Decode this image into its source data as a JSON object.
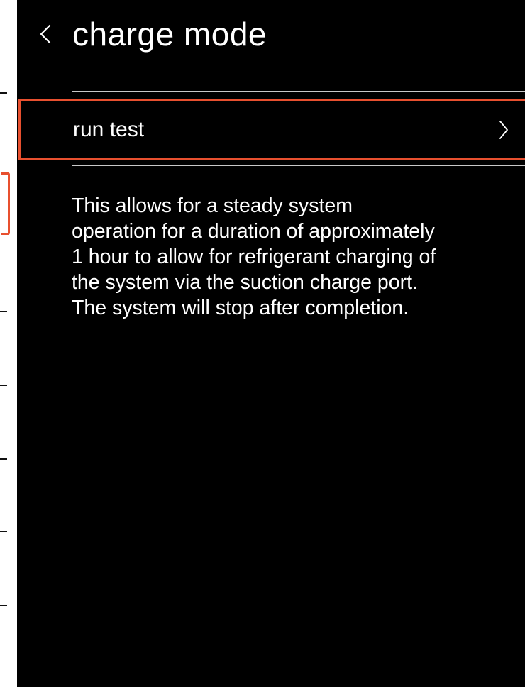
{
  "header": {
    "title": "charge mode",
    "back_icon": "chevron-left-icon"
  },
  "menu": {
    "items": [
      {
        "label": "run test",
        "icon": "chevron-right-icon",
        "selected": true
      }
    ]
  },
  "description": {
    "lines": [
      "This allows for a steady system",
      "operation for a duration of approximately",
      "1 hour to allow for refrigerant charging of",
      "the system via the suction charge port.",
      "The system will stop after completion."
    ]
  },
  "colors": {
    "background": "#000000",
    "text": "#ffffff",
    "highlight": "#e8502f",
    "divider": "#c8c8c8"
  }
}
